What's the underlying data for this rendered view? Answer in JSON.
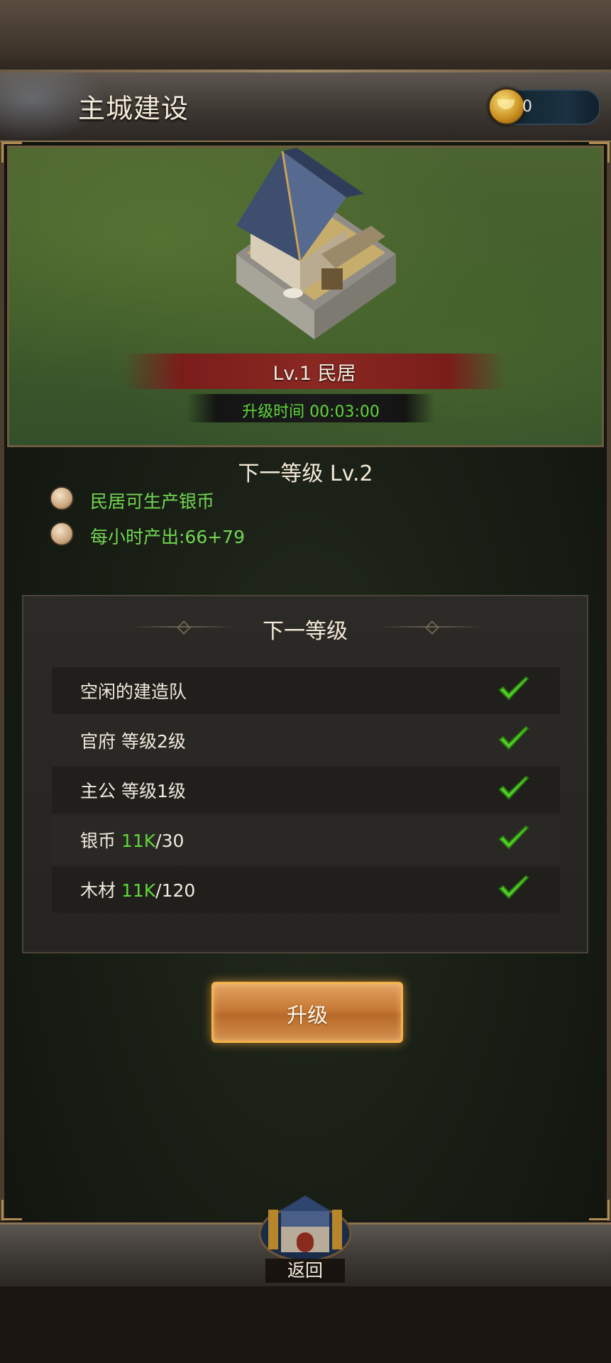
{
  "header": {
    "title": "主城建设",
    "currency_value": "0",
    "currency_icon": "gold-ingot-icon"
  },
  "building": {
    "level_name": "Lv.1 民居",
    "upgrade_time": "升级时间 00:03:00"
  },
  "next_level": {
    "title": "下一等级 Lv.2",
    "benefits": [
      "民居可生产银币",
      "每小时产出:66+79"
    ]
  },
  "requirements": {
    "title": "下一等级",
    "rows": [
      {
        "label": "空闲的建造队",
        "have": "",
        "need": ""
      },
      {
        "label": "官府 等级2级",
        "have": "",
        "need": ""
      },
      {
        "label": "主公 等级1级",
        "have": "",
        "need": ""
      },
      {
        "label": "银币 ",
        "have": "11K",
        "need": "/30"
      },
      {
        "label": "木材 ",
        "have": "11K",
        "need": "/120"
      }
    ]
  },
  "actions": {
    "upgrade_label": "升级",
    "back_label": "返回"
  },
  "colors": {
    "green_text": "#5fd73a",
    "banner_red": "#8a2822",
    "button_orange": "#c67a35"
  }
}
